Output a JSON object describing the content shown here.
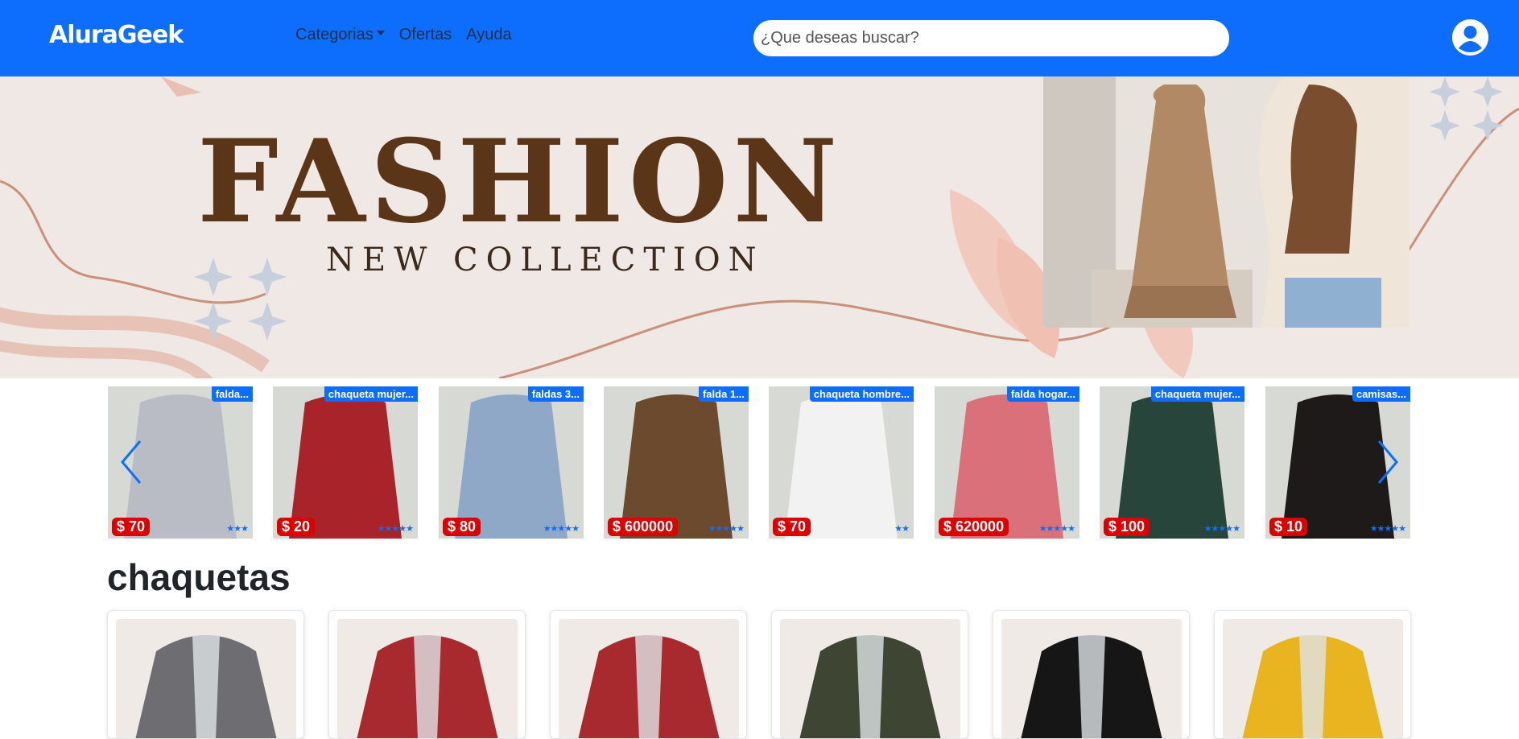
{
  "navbar": {
    "brand": "AluraGeek",
    "links": [
      "Categorias",
      "Ofertas",
      "Ayuda"
    ],
    "search_placeholder": "¿Que deseas buscar?"
  },
  "hero": {
    "title": "FASHION",
    "subtitle": "NEW COLLECTION"
  },
  "carousel": {
    "items": [
      {
        "tag": "falda...",
        "price": "$ 70",
        "stars": "★★★",
        "color": "#b9bcc4"
      },
      {
        "tag": "chaqueta mujer...",
        "price": "$ 20",
        "stars": "★★★★★",
        "color": "#a8232a"
      },
      {
        "tag": "faldas 3...",
        "price": "$ 80",
        "stars": "★★★★★",
        "color": "#8fa8c8"
      },
      {
        "tag": "falda 1...",
        "price": "$ 600000",
        "stars": "★★★★★",
        "color": "#6b4a2e"
      },
      {
        "tag": "chaqueta hombre...",
        "price": "$ 70",
        "stars": "★★",
        "color": "#f2f2f2"
      },
      {
        "tag": "falda hogar...",
        "price": "$ 620000",
        "stars": "★★★★★",
        "color": "#d9707a"
      },
      {
        "tag": "chaqueta mujer...",
        "price": "$ 100",
        "stars": "★★★★★",
        "color": "#27453a"
      },
      {
        "tag": "camisas...",
        "price": "$ 10",
        "stars": "★★★★★",
        "color": "#1e1a1a"
      }
    ]
  },
  "section": {
    "title": "chaquetas",
    "cards": [
      {
        "color": "#6e6e72"
      },
      {
        "color": "#a82a2e"
      },
      {
        "color": "#a82a2e"
      },
      {
        "color": "#3f4533"
      },
      {
        "color": "#161616"
      },
      {
        "color": "#e8b521"
      }
    ]
  }
}
